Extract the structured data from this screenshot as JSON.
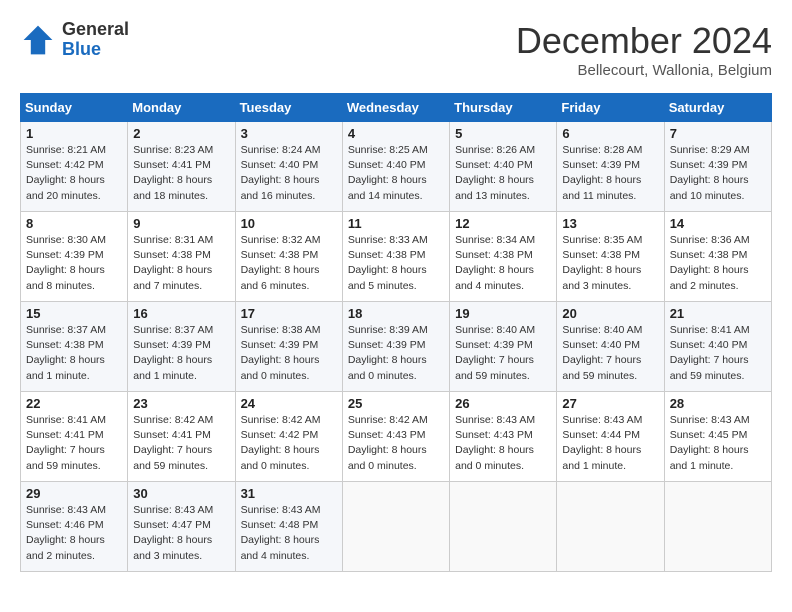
{
  "logo": {
    "general": "General",
    "blue": "Blue"
  },
  "title": "December 2024",
  "subtitle": "Bellecourt, Wallonia, Belgium",
  "days_header": [
    "Sunday",
    "Monday",
    "Tuesday",
    "Wednesday",
    "Thursday",
    "Friday",
    "Saturday"
  ],
  "weeks": [
    [
      {
        "day": "1",
        "sunrise": "8:21 AM",
        "sunset": "4:42 PM",
        "daylight": "8 hours and 20 minutes."
      },
      {
        "day": "2",
        "sunrise": "8:23 AM",
        "sunset": "4:41 PM",
        "daylight": "8 hours and 18 minutes."
      },
      {
        "day": "3",
        "sunrise": "8:24 AM",
        "sunset": "4:40 PM",
        "daylight": "8 hours and 16 minutes."
      },
      {
        "day": "4",
        "sunrise": "8:25 AM",
        "sunset": "4:40 PM",
        "daylight": "8 hours and 14 minutes."
      },
      {
        "day": "5",
        "sunrise": "8:26 AM",
        "sunset": "4:40 PM",
        "daylight": "8 hours and 13 minutes."
      },
      {
        "day": "6",
        "sunrise": "8:28 AM",
        "sunset": "4:39 PM",
        "daylight": "8 hours and 11 minutes."
      },
      {
        "day": "7",
        "sunrise": "8:29 AM",
        "sunset": "4:39 PM",
        "daylight": "8 hours and 10 minutes."
      }
    ],
    [
      {
        "day": "8",
        "sunrise": "8:30 AM",
        "sunset": "4:39 PM",
        "daylight": "8 hours and 8 minutes."
      },
      {
        "day": "9",
        "sunrise": "8:31 AM",
        "sunset": "4:38 PM",
        "daylight": "8 hours and 7 minutes."
      },
      {
        "day": "10",
        "sunrise": "8:32 AM",
        "sunset": "4:38 PM",
        "daylight": "8 hours and 6 minutes."
      },
      {
        "day": "11",
        "sunrise": "8:33 AM",
        "sunset": "4:38 PM",
        "daylight": "8 hours and 5 minutes."
      },
      {
        "day": "12",
        "sunrise": "8:34 AM",
        "sunset": "4:38 PM",
        "daylight": "8 hours and 4 minutes."
      },
      {
        "day": "13",
        "sunrise": "8:35 AM",
        "sunset": "4:38 PM",
        "daylight": "8 hours and 3 minutes."
      },
      {
        "day": "14",
        "sunrise": "8:36 AM",
        "sunset": "4:38 PM",
        "daylight": "8 hours and 2 minutes."
      }
    ],
    [
      {
        "day": "15",
        "sunrise": "8:37 AM",
        "sunset": "4:38 PM",
        "daylight": "8 hours and 1 minute."
      },
      {
        "day": "16",
        "sunrise": "8:37 AM",
        "sunset": "4:39 PM",
        "daylight": "8 hours and 1 minute."
      },
      {
        "day": "17",
        "sunrise": "8:38 AM",
        "sunset": "4:39 PM",
        "daylight": "8 hours and 0 minutes."
      },
      {
        "day": "18",
        "sunrise": "8:39 AM",
        "sunset": "4:39 PM",
        "daylight": "8 hours and 0 minutes."
      },
      {
        "day": "19",
        "sunrise": "8:40 AM",
        "sunset": "4:39 PM",
        "daylight": "7 hours and 59 minutes."
      },
      {
        "day": "20",
        "sunrise": "8:40 AM",
        "sunset": "4:40 PM",
        "daylight": "7 hours and 59 minutes."
      },
      {
        "day": "21",
        "sunrise": "8:41 AM",
        "sunset": "4:40 PM",
        "daylight": "7 hours and 59 minutes."
      }
    ],
    [
      {
        "day": "22",
        "sunrise": "8:41 AM",
        "sunset": "4:41 PM",
        "daylight": "7 hours and 59 minutes."
      },
      {
        "day": "23",
        "sunrise": "8:42 AM",
        "sunset": "4:41 PM",
        "daylight": "7 hours and 59 minutes."
      },
      {
        "day": "24",
        "sunrise": "8:42 AM",
        "sunset": "4:42 PM",
        "daylight": "8 hours and 0 minutes."
      },
      {
        "day": "25",
        "sunrise": "8:42 AM",
        "sunset": "4:43 PM",
        "daylight": "8 hours and 0 minutes."
      },
      {
        "day": "26",
        "sunrise": "8:43 AM",
        "sunset": "4:43 PM",
        "daylight": "8 hours and 0 minutes."
      },
      {
        "day": "27",
        "sunrise": "8:43 AM",
        "sunset": "4:44 PM",
        "daylight": "8 hours and 1 minute."
      },
      {
        "day": "28",
        "sunrise": "8:43 AM",
        "sunset": "4:45 PM",
        "daylight": "8 hours and 1 minute."
      }
    ],
    [
      {
        "day": "29",
        "sunrise": "8:43 AM",
        "sunset": "4:46 PM",
        "daylight": "8 hours and 2 minutes."
      },
      {
        "day": "30",
        "sunrise": "8:43 AM",
        "sunset": "4:47 PM",
        "daylight": "8 hours and 3 minutes."
      },
      {
        "day": "31",
        "sunrise": "8:43 AM",
        "sunset": "4:48 PM",
        "daylight": "8 hours and 4 minutes."
      },
      null,
      null,
      null,
      null
    ]
  ],
  "labels": {
    "sunrise": "Sunrise:",
    "sunset": "Sunset:",
    "daylight": "Daylight:"
  }
}
